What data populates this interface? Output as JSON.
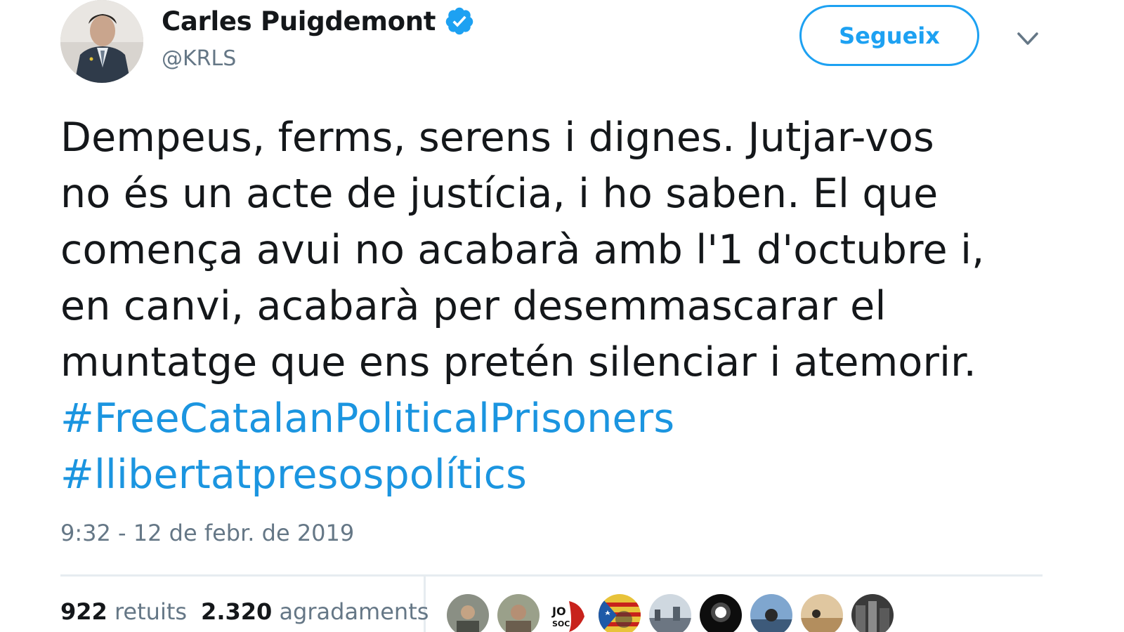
{
  "user": {
    "display_name": "Carles Puigdemont",
    "handle": "@KRLS"
  },
  "actions": {
    "follow_label": "Segueix"
  },
  "tweet": {
    "lines": [
      "Dempeus, ferms, serens i dignes. Jutjar-vos",
      "no és un acte de justícia, i ho saben. El que",
      "comença avui no acabarà amb l'1 d'octubre i,",
      "en canvi,  acabarà per desemmascarar el",
      "muntatge que ens pretén silenciar i atemorir."
    ],
    "hashtags": [
      "#FreeCatalanPoliticalPrisoners",
      "#llibertatpresospolítics"
    ],
    "timestamp": "9:32 - 12 de febr. de 2019"
  },
  "stats": {
    "retweets_count": "922",
    "retweets_label": "retuits",
    "likes_count": "2.320",
    "likes_label": "agradaments"
  },
  "colors": {
    "accent": "#1da1f2",
    "hashtag": "#1b95e0",
    "muted": "#657786",
    "text": "#14171a"
  },
  "icons": {
    "verified": "verified-badge-icon",
    "caret": "chevron-down-icon"
  }
}
